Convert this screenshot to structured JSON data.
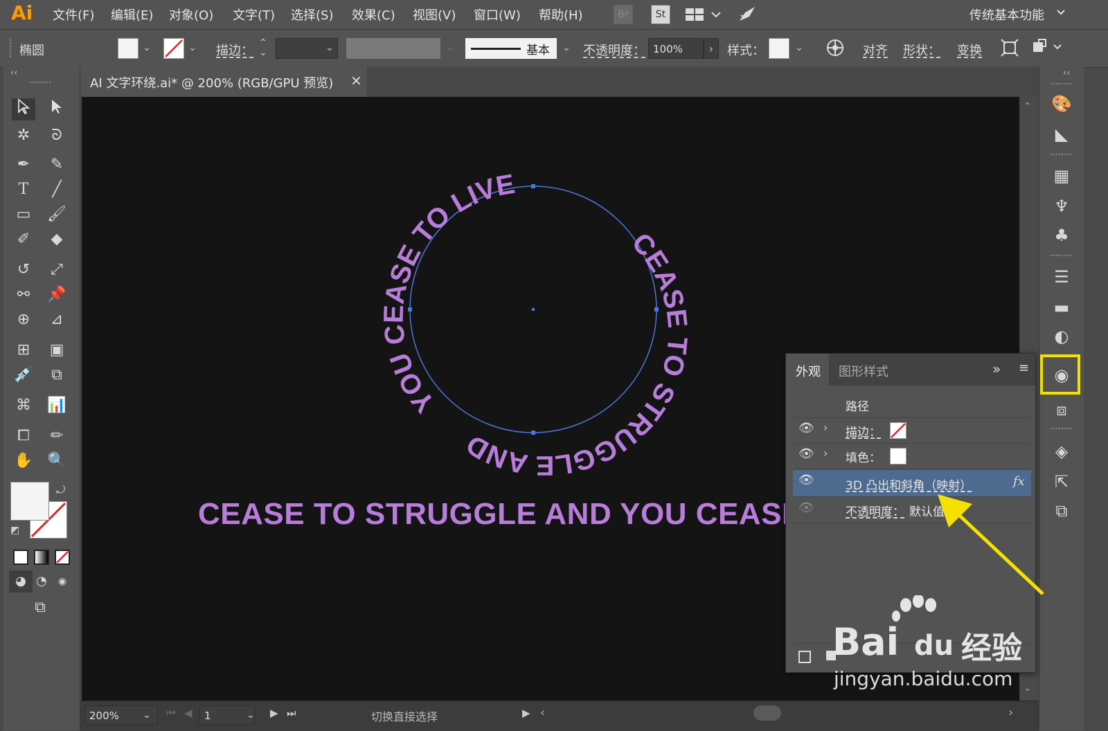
{
  "app": {
    "logo": "Ai",
    "workspace": "传统基本功能"
  },
  "menu": [
    "文件(F)",
    "编辑(E)",
    "对象(O)",
    "文字(T)",
    "选择(S)",
    "效果(C)",
    "视图(V)",
    "窗口(W)",
    "帮助(H)"
  ],
  "menu_icons": {
    "bridge": "Br",
    "stock": "St"
  },
  "control_bar": {
    "object_type": "椭圆",
    "stroke_label": "描边：",
    "stroke_style": "基本",
    "opacity_label": "不透明度：",
    "opacity_value": "100%",
    "style_label": "样式：",
    "align_label": "对齐",
    "shape_label": "形状：",
    "transform_label": "变换"
  },
  "document_tab": {
    "title": "AI 文字环绕.ai* @ 200% (RGB/GPU 预览)",
    "close": "×"
  },
  "collapse_left": "‹‹",
  "collapse_right": "‹‹",
  "canvas": {
    "circle_text_upper": "YOU CEASE TO LIVE",
    "circle_text_lower": "CEASE TO STRUGGLE AND",
    "main_text": "CEASE TO STRUGGLE AND YOU CEASE TO",
    "text_color": "#b87ddb",
    "selection_color": "#4a78e0"
  },
  "appearance_panel": {
    "tab_active": "外观",
    "tab_inactive": "图形样式",
    "overflow": "»",
    "menu": "≡",
    "object": "路径",
    "rows": {
      "stroke_label": "描边：",
      "fill_label": "填色：",
      "effect_label": "3D 凸出和斜角（映射）",
      "effect_fx": "fx",
      "opacity_label": "不透明度：",
      "opacity_value": "默认值"
    }
  },
  "status_bar": {
    "zoom": "200%",
    "artboard": "1",
    "tool_hint": "切换直接选择"
  },
  "watermark": {
    "brand": "Bai",
    "brand2": "du",
    "brand3": "经验",
    "url": "jingyan.baidu.com"
  },
  "colors": {
    "highlight": "#f5e100",
    "arrow": "#f5e100",
    "selected_row": "#4d6a8f"
  }
}
